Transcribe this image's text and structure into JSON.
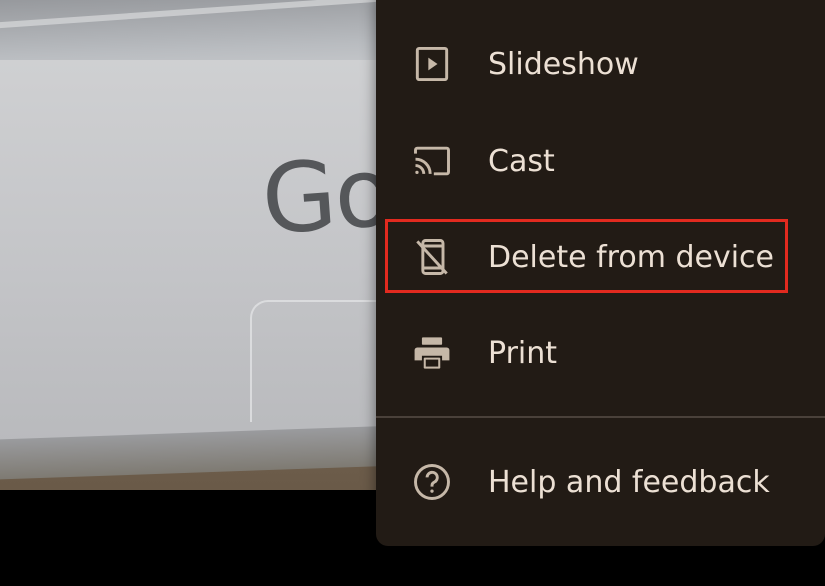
{
  "photo": {
    "logo_text": "Go"
  },
  "menu": {
    "items": [
      {
        "label": "Slideshow",
        "icon": "slideshow-icon"
      },
      {
        "label": "Cast",
        "icon": "cast-icon"
      },
      {
        "label": "Delete from device",
        "icon": "delete-from-device-icon"
      },
      {
        "label": "Print",
        "icon": "print-icon"
      },
      {
        "label": "Help and feedback",
        "icon": "help-icon"
      }
    ]
  },
  "colors": {
    "menu_background": "#221b15",
    "menu_text": "#ece0d4",
    "icon_color": "#c6b8a8",
    "highlight": "#e22a1f"
  }
}
